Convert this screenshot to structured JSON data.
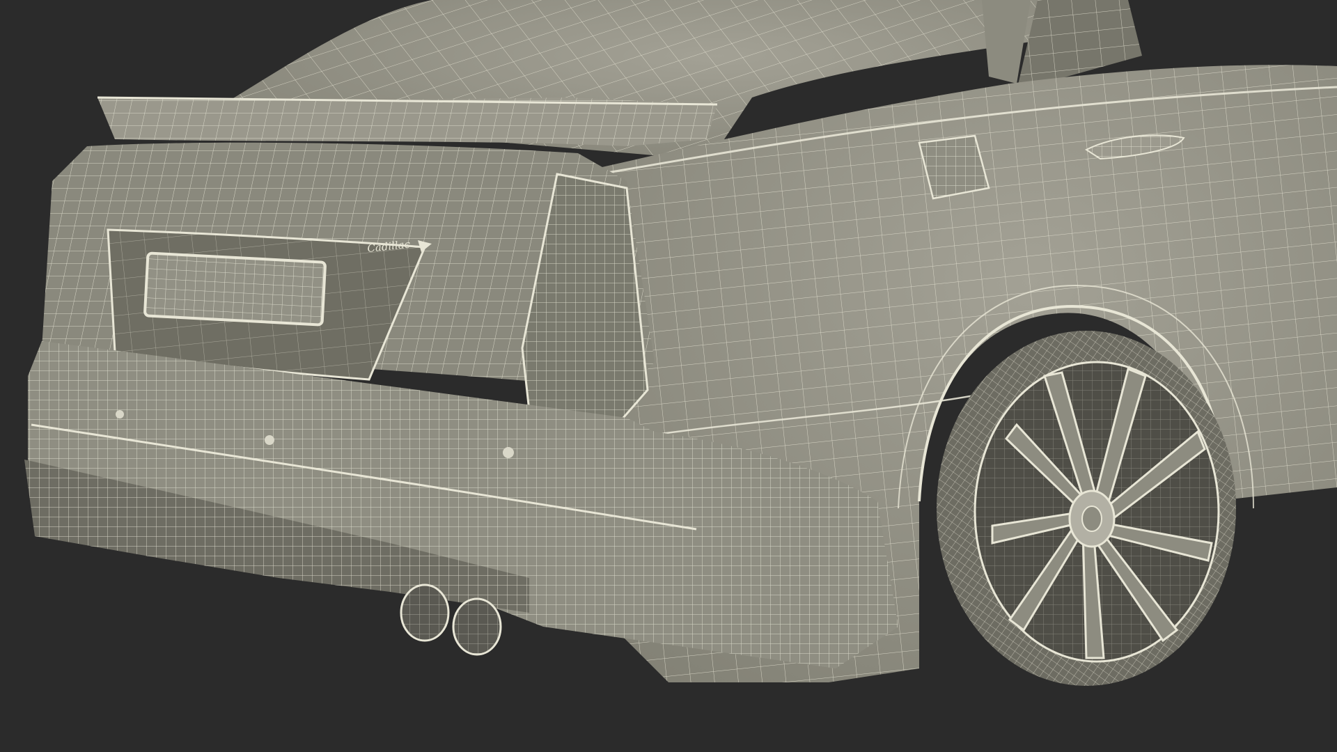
{
  "scene": {
    "description_name": "car-rear-wireframe-render",
    "colors": {
      "background": "#2b2b2b",
      "body_fill": "#8e8d80",
      "body_shadow": "#6f6e63",
      "body_highlight": "#a19f93",
      "wire": "#e8e6d6",
      "tire": "#77766b",
      "rim_dark": "#4f4e47"
    }
  },
  "badge": {
    "text": "Cadillac"
  }
}
